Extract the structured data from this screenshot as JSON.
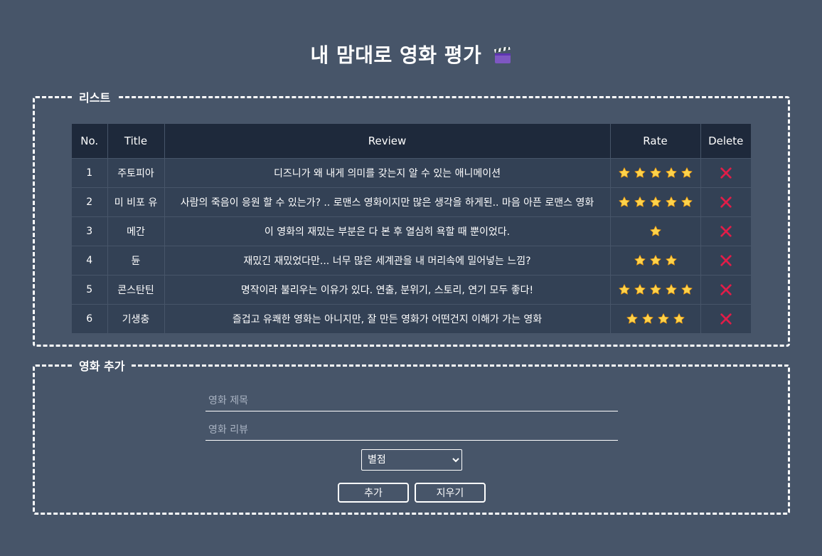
{
  "page": {
    "title": "내 맘대로 영화 평가",
    "title_icon": "clapper-board-icon"
  },
  "list_section": {
    "legend": "리스트",
    "columns": [
      "No.",
      "Title",
      "Review",
      "Rate",
      "Delete"
    ],
    "rows": [
      {
        "no": "1",
        "title": "주토피아",
        "review": "디즈니가 왜 내게 의미를 갖는지 알 수 있는 애니메이션",
        "rate": 5
      },
      {
        "no": "2",
        "title": "미 비포 유",
        "review": "사람의 죽음이 응원 할 수 있는가? .. 로맨스 영화이지만 많은 생각을 하게된.. 마음 아픈 로맨스 영화",
        "rate": 5
      },
      {
        "no": "3",
        "title": "메간",
        "review": "이 영화의 재밌는 부분은 다 본 후 열심히 욕할 때 뿐이었다.",
        "rate": 1
      },
      {
        "no": "4",
        "title": "듄",
        "review": "재밌긴 재밌었다만... 너무 많은 세계관을 내 머리속에 밀어넣는 느낌?",
        "rate": 3
      },
      {
        "no": "5",
        "title": "콘스탄틴",
        "review": "명작이라 불리우는 이유가 있다. 연출, 분위기, 스토리, 연기 모두 좋다!",
        "rate": 5
      },
      {
        "no": "6",
        "title": "기생충",
        "review": "즐겁고 유쾌한 영화는 아니지만, 잘 만든 영화가 어떤건지 이해가 가는 영화",
        "rate": 4
      }
    ],
    "star_icon": "star-icon",
    "delete_icon": "close-icon",
    "star_color": "#fcd34d",
    "delete_color": "#e11d48"
  },
  "add_section": {
    "legend": "영화 추가",
    "title_placeholder": "영화 제목",
    "review_placeholder": "영화 리뷰",
    "rate_select": {
      "selected": "별점"
    },
    "add_button": "추가",
    "clear_button": "지우기"
  },
  "colors": {
    "background": "#475569",
    "table_header": "#1e293b",
    "table_row": "#334155"
  }
}
